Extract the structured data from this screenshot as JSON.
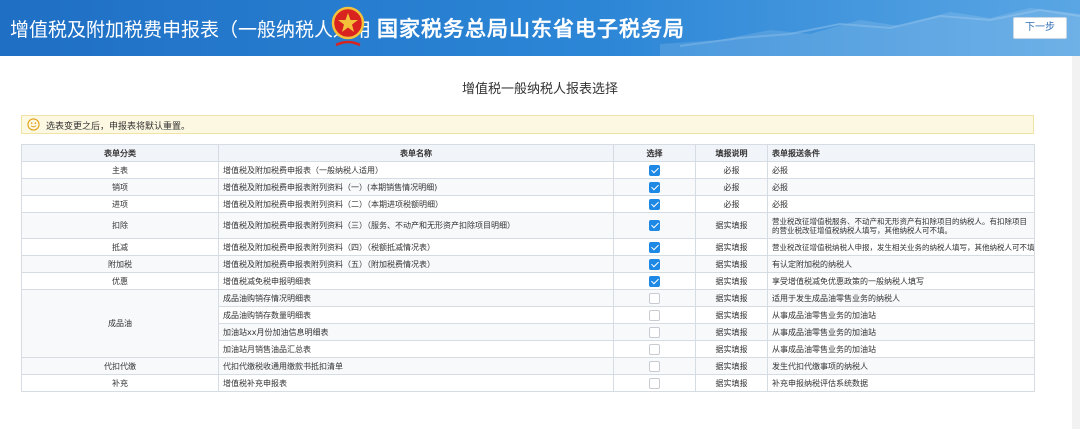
{
  "header": {
    "form_title": "增值税及附加税费申报表（一般纳税人适用",
    "org_name": "国家税务总局山东省电子税务局",
    "next_label": "下一步",
    "colors": {
      "bar": "#2c86d6",
      "emblem_red": "#d8231e",
      "emblem_gold": "#f3c13a"
    }
  },
  "page": {
    "title": "增值税一般纳税人报表选择"
  },
  "notice": {
    "text": "选表变更之后，申报表将默认重置。",
    "icon": "smile-icon"
  },
  "table": {
    "headers": [
      "表单分类",
      "表单名称",
      "选择",
      "填报说明",
      "表单报送条件"
    ],
    "rows": [
      {
        "category": "主表",
        "name": "增值税及附加税费申报表（一般纳税人适用）",
        "checked": true,
        "req": "必报",
        "cond": "必报"
      },
      {
        "category": "销项",
        "name": "增值税及附加税费申报表附列资料（一）(本期销售情况明细)",
        "checked": true,
        "req": "必报",
        "cond": "必报"
      },
      {
        "category": "进项",
        "name": "增值税及附加税费申报表附列资料（二）（本期进项税额明细）",
        "checked": true,
        "req": "必报",
        "cond": "必报"
      },
      {
        "category": "扣除",
        "name": "增值税及附加税费申报表附列资料（三）（服务、不动产和无形资产扣除项目明细）",
        "checked": true,
        "req": "据实填报",
        "cond": "营业税改征增值税服务、不动产和无形资产有扣除项目的纳税人。有扣除项目的营业税改征增值税纳税人填写，其他纳税人可不填。"
      },
      {
        "category": "抵减",
        "name": "增值税及附加税费申报表附列资料（四）（税额抵减情况表）",
        "checked": true,
        "req": "据实填报",
        "cond": "营业税改征增值税纳税人申报，发生相关业务的纳税人填写，其他纳税人可不填"
      },
      {
        "category": "附加税",
        "name": "增值税及附加税费申报表附列资料（五）（附加税费情况表）",
        "checked": true,
        "req": "据实填报",
        "cond": "有认定附加税的纳税人"
      },
      {
        "category": "优惠",
        "name": "增值税减免税申报明细表",
        "checked": true,
        "req": "据实填报",
        "cond": "享受增值税减免优惠政策的一般纳税人填写"
      },
      {
        "category": "",
        "name": "成品油购销存情况明细表",
        "checked": false,
        "req": "据实填报",
        "cond": "适用于发生成品油零售业务的纳税人"
      },
      {
        "category": "成品油",
        "name": "成品油购销存数量明细表",
        "checked": false,
        "req": "据实填报",
        "cond": "从事成品油零售业务的加油站"
      },
      {
        "category": "",
        "name": "加油站xx月份加油信息明细表",
        "checked": false,
        "req": "据实填报",
        "cond": "从事成品油零售业务的加油站"
      },
      {
        "category": "",
        "name": "加油站月销售油品汇总表",
        "checked": false,
        "req": "据实填报",
        "cond": "从事成品油零售业务的加油站"
      },
      {
        "category": "代扣代缴",
        "name": "代扣代缴税收通用缴款书抵扣清单",
        "checked": false,
        "req": "据实填报",
        "cond": "发生代扣代缴事项的纳税人"
      },
      {
        "category": "补充",
        "name": "增值税补充申报表",
        "checked": false,
        "req": "据实填报",
        "cond": "补充申报纳税评估系统数据"
      }
    ]
  }
}
